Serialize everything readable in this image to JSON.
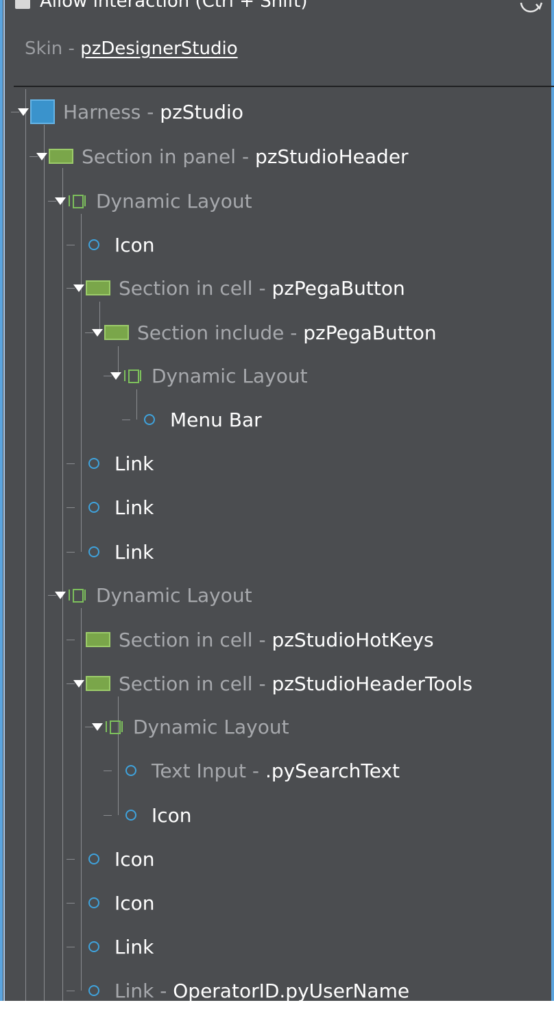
{
  "toolbar": {
    "allow_interaction_label": "Allow interaction (Ctrl + Shift)",
    "refresh_icon": "refresh-icon"
  },
  "skin": {
    "label": "Skin - ",
    "value": "pzDesignerStudio"
  },
  "colors": {
    "panel_bg": "#4b4d50",
    "accent_blue": "#3fa3dd",
    "section_green": "#7aa64a",
    "muted_text": "#a7a9ad"
  },
  "tree": [
    {
      "type": "Harness",
      "name": "pzStudio",
      "icon": "harness-icon",
      "expanded": true
    },
    {
      "type": "Section in panel",
      "name": "pzStudioHeader",
      "icon": "section-icon",
      "expanded": true
    },
    {
      "type": "Dynamic Layout",
      "name": "",
      "icon": "layout-icon",
      "expanded": true
    },
    {
      "type": "Icon",
      "name": "",
      "icon": "control-icon"
    },
    {
      "type": "Section in cell",
      "name": "pzPegaButton",
      "icon": "section-icon",
      "expanded": true
    },
    {
      "type": "Section include",
      "name": "pzPegaButton",
      "icon": "section-icon",
      "expanded": true
    },
    {
      "type": "Dynamic Layout",
      "name": "",
      "icon": "layout-icon",
      "expanded": true
    },
    {
      "type": "Menu Bar",
      "name": "",
      "icon": "control-icon"
    },
    {
      "type": "Link",
      "name": "",
      "icon": "control-icon"
    },
    {
      "type": "Link",
      "name": "",
      "icon": "control-icon"
    },
    {
      "type": "Link",
      "name": "",
      "icon": "control-icon"
    },
    {
      "type": "Dynamic Layout",
      "name": "",
      "icon": "layout-icon",
      "expanded": true
    },
    {
      "type": "Section in cell",
      "name": "pzStudioHotKeys",
      "icon": "section-icon"
    },
    {
      "type": "Section in cell",
      "name": "pzStudioHeaderTools",
      "icon": "section-icon",
      "expanded": true
    },
    {
      "type": "Dynamic Layout",
      "name": "",
      "icon": "layout-icon",
      "expanded": true
    },
    {
      "type": "Text Input",
      "name": ".pySearchText",
      "icon": "control-icon"
    },
    {
      "type": "Icon",
      "name": "",
      "icon": "control-icon"
    },
    {
      "type": "Icon",
      "name": "",
      "icon": "control-icon"
    },
    {
      "type": "Icon",
      "name": "",
      "icon": "control-icon"
    },
    {
      "type": "Link",
      "name": "",
      "icon": "control-icon"
    },
    {
      "type": "Link",
      "name": "OperatorID.pyUserName",
      "icon": "control-icon"
    }
  ]
}
